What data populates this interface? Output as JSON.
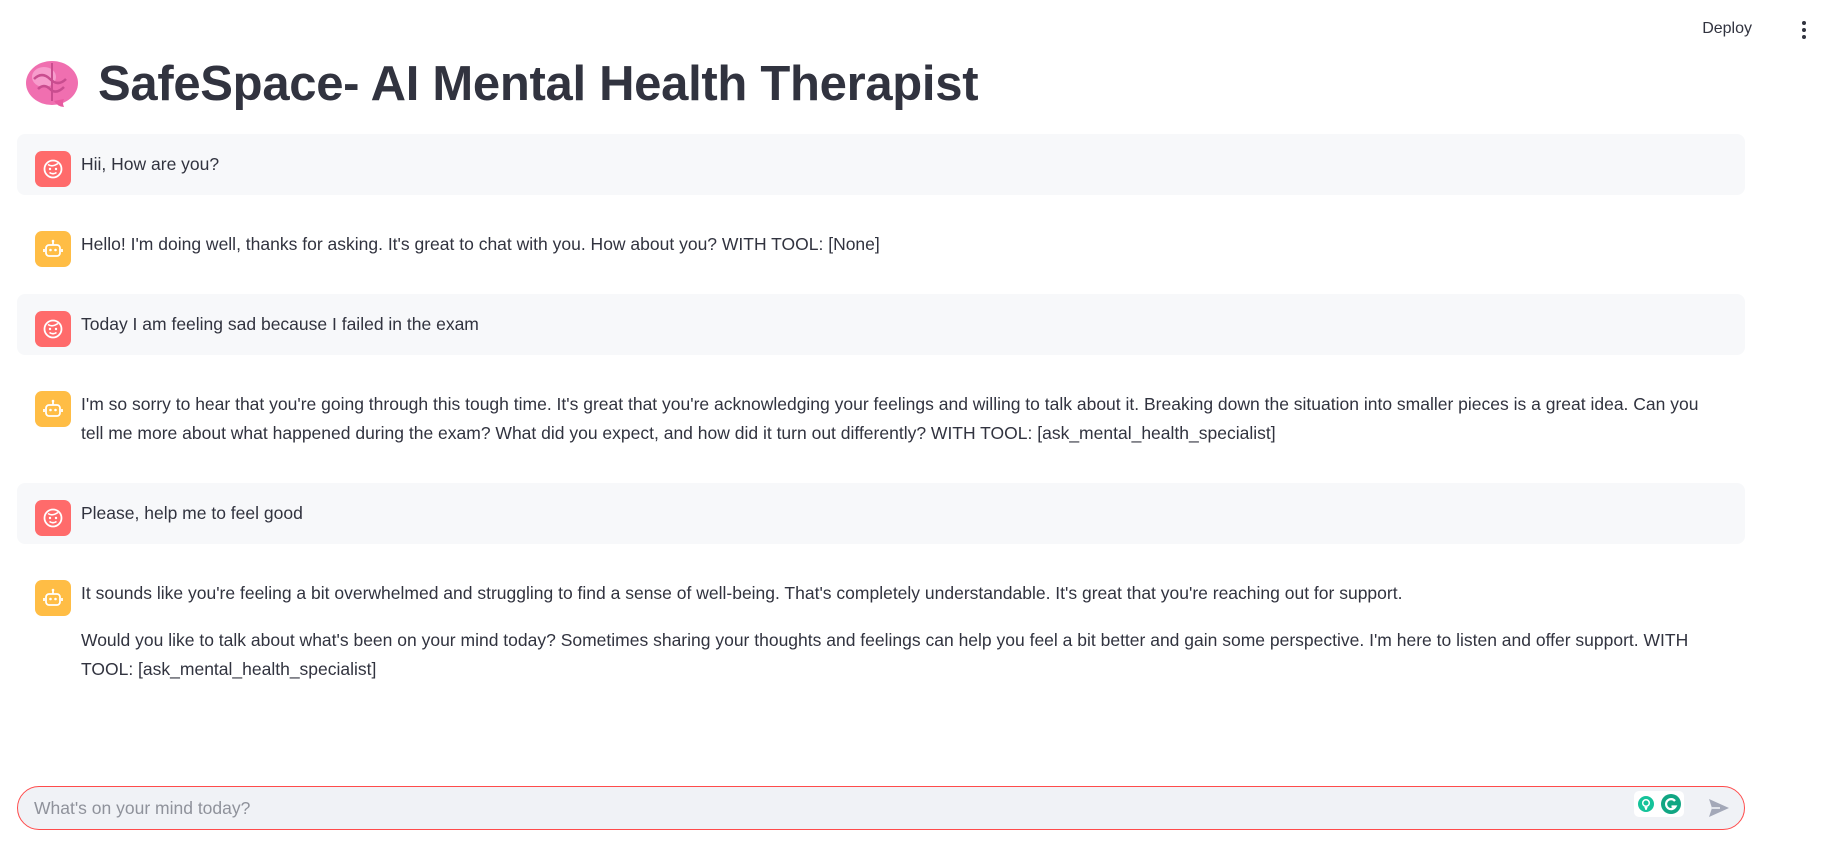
{
  "header": {
    "deploy_label": "Deploy",
    "menu_icon": "kebab-menu-icon"
  },
  "page": {
    "title_icon": "brain-emoji-icon",
    "title": "SafeSpace- AI Mental Health Therapist"
  },
  "messages": [
    {
      "role": "user",
      "avatar_icon": "user-face-icon",
      "paragraphs": [
        "Hii, How are you?"
      ]
    },
    {
      "role": "assistant",
      "avatar_icon": "robot-icon",
      "paragraphs": [
        "Hello! I'm doing well, thanks for asking. It's great to chat with you. How about you? WITH TOOL: [None]"
      ]
    },
    {
      "role": "user",
      "avatar_icon": "user-face-icon",
      "paragraphs": [
        "Today I am feeling sad because I failed in the exam"
      ]
    },
    {
      "role": "assistant",
      "avatar_icon": "robot-icon",
      "paragraphs": [
        "I'm so sorry to hear that you're going through this tough time. It's great that you're acknowledging your feelings and willing to talk about it. Breaking down the situation into smaller pieces is a great idea. Can you tell me more about what happened during the exam? What did you expect, and how did it turn out differently? WITH TOOL: [ask_mental_health_specialist]"
      ]
    },
    {
      "role": "user",
      "avatar_icon": "user-face-icon",
      "paragraphs": [
        "Please, help me to feel good"
      ]
    },
    {
      "role": "assistant",
      "avatar_icon": "robot-icon",
      "paragraphs": [
        "It sounds like you're feeling a bit overwhelmed and struggling to find a sense of well-being. That's completely understandable. It's great that you're reaching out for support.",
        "Would you like to talk about what's been on your mind today? Sometimes sharing your thoughts and feelings can help you feel a bit better and gain some perspective. I'm here to listen and offer support. WITH TOOL: [ask_mental_health_specialist]"
      ]
    }
  ],
  "chat_input": {
    "value": "",
    "placeholder": "What's on your mind today?",
    "extension_icons": [
      "lightbulb-icon",
      "grammarly-icon"
    ],
    "send_icon": "send-icon"
  },
  "colors": {
    "user_avatar": "#ff6b6b",
    "assistant_avatar": "#ffbd45",
    "input_border": "#ff4b4b",
    "user_message_bg": "#f7f8fa"
  }
}
